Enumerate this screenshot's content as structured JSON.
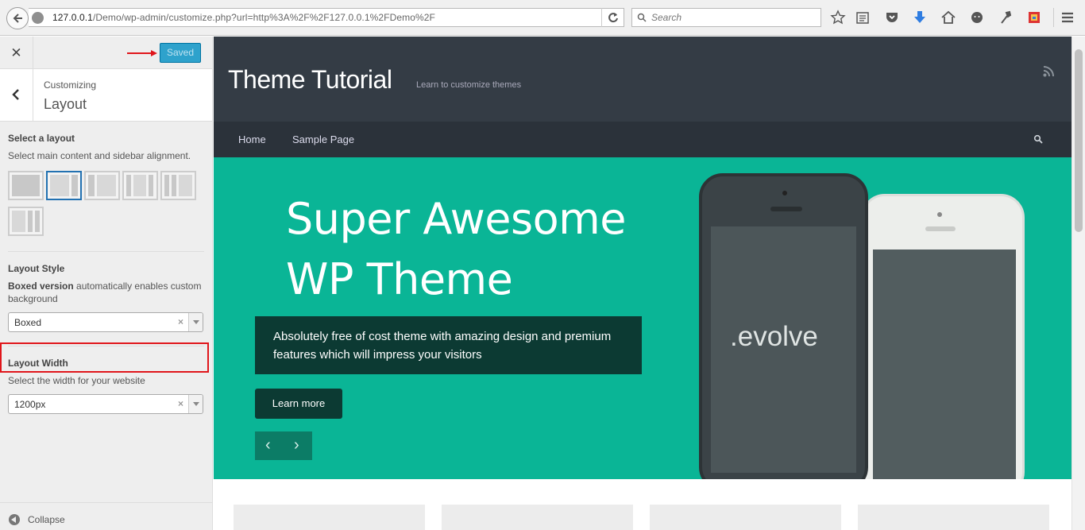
{
  "browser": {
    "url_host": "127.0.0.1",
    "url_rest": "/Demo/wp-admin/customize.php?url=http%3A%2F%2F127.0.0.1%2FDemo%2F",
    "search_placeholder": "Search"
  },
  "customizer": {
    "saved_label": "Saved",
    "customizing_label": "Customizing",
    "section_title": "Layout",
    "select_layout": {
      "title": "Select a layout",
      "description": "Select main content and sidebar alignment.",
      "selected_index": 1
    },
    "layout_style": {
      "title": "Layout Style",
      "description_bold": "Boxed version",
      "description_rest": " automatically enables custom background",
      "value": "Boxed"
    },
    "layout_width": {
      "title": "Layout Width",
      "description": "Select the width for your website",
      "value": "1200px"
    },
    "collapse_label": "Collapse"
  },
  "preview": {
    "site_title": "Theme Tutorial",
    "tagline": "Learn to customize themes",
    "nav": [
      "Home",
      "Sample Page"
    ],
    "hero_title_line1": "Super Awesome",
    "hero_title_line2": "WP Theme",
    "hero_text": "Absolutely free of cost theme with amazing design and premium features which will impress your visitors",
    "learn_more": "Learn more",
    "phone_brand": ".evolve",
    "prev_arrow": "‹",
    "next_arrow": "›"
  },
  "colors": {
    "hero": "#0ab596",
    "header": "#343c45",
    "accent": "#2ea2cc",
    "highlight": "#e0161b"
  }
}
